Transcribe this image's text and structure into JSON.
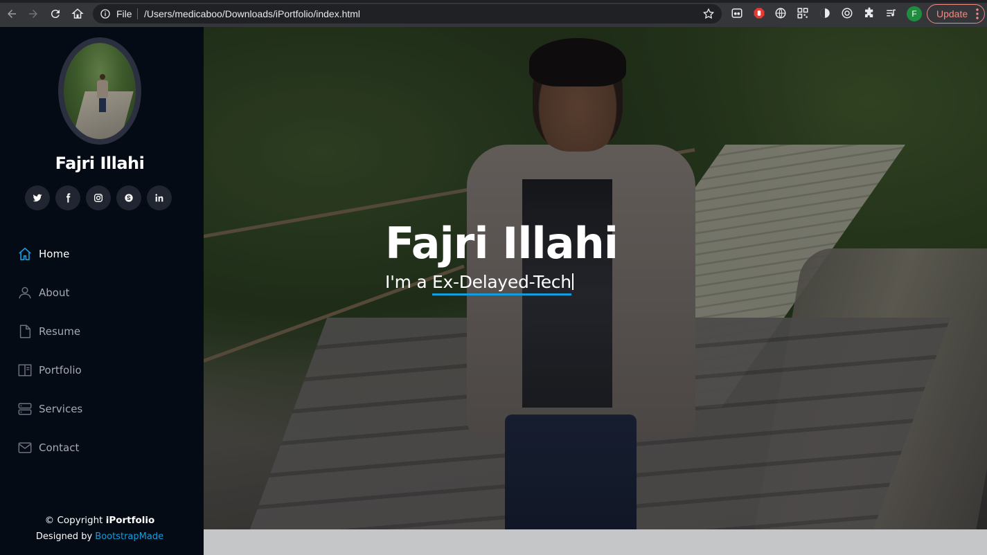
{
  "browser": {
    "scheme_label": "File",
    "url": "/Users/medicaboo/Downloads/iPortfolio/index.html",
    "profile_initial": "F",
    "update_label": "Update",
    "accent_update": "#f28b82"
  },
  "sidebar": {
    "name": "Fajri Illahi",
    "socials": [
      {
        "icon": "twitter-icon"
      },
      {
        "icon": "facebook-icon"
      },
      {
        "icon": "instagram-icon"
      },
      {
        "icon": "skype-icon"
      },
      {
        "icon": "linkedin-icon"
      }
    ],
    "nav": [
      {
        "label": "Home",
        "icon": "home-icon",
        "active": true
      },
      {
        "label": "About",
        "icon": "person-icon"
      },
      {
        "label": "Resume",
        "icon": "file-icon"
      },
      {
        "label": "Portfolio",
        "icon": "book-icon"
      },
      {
        "label": "Services",
        "icon": "server-icon"
      },
      {
        "label": "Contact",
        "icon": "envelope-icon"
      }
    ],
    "footer": {
      "copyright_prefix": "© Copyright ",
      "brand": "iPortfolio",
      "designed_prefix": "Designed by ",
      "designer_link": "BootstrapMade"
    },
    "accent": "#149ddd"
  },
  "hero": {
    "title": "Fajri Illahi",
    "subtitle_prefix": "I'm a ",
    "typed_text": "Ex-Delayed-Tech"
  }
}
